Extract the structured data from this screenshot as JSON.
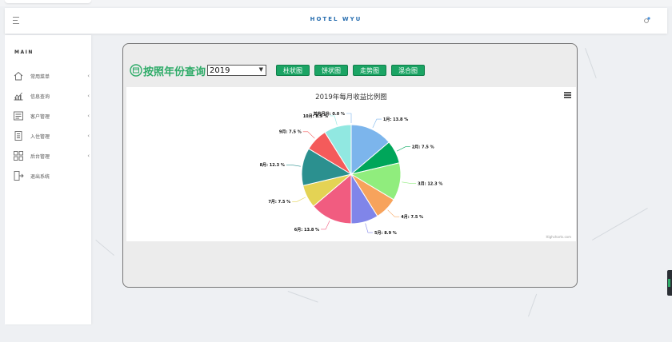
{
  "header": {
    "brand": "HOTEL WYU"
  },
  "sidebar": {
    "section_label": "MAIN",
    "items": [
      {
        "label": "常用菜单",
        "icon": "home-icon",
        "has_children": true
      },
      {
        "label": "信息查询",
        "icon": "chart-icon",
        "has_children": true
      },
      {
        "label": "客户管理",
        "icon": "customer-icon",
        "has_children": true
      },
      {
        "label": "入住管理",
        "icon": "checkin-icon",
        "has_children": true
      },
      {
        "label": "后台管理",
        "icon": "grid-icon",
        "has_children": true
      },
      {
        "label": "退出系统",
        "icon": "logout-icon",
        "has_children": false
      }
    ],
    "chevron": "‹"
  },
  "toolbar": {
    "title": "按照年份查询",
    "year_value": "2019",
    "buttons": [
      "柱状图",
      "饼状图",
      "走势图",
      "混合图"
    ]
  },
  "chart_data": {
    "type": "pie",
    "title": "2019年每月收益比例图",
    "credit": "Highcharts.com",
    "slices": [
      {
        "label": "1月: 13.8 %",
        "value": 13.8,
        "color": "#7cb5ec"
      },
      {
        "label": "2月: 7.5 %",
        "value": 7.5,
        "color": "#00a65a"
      },
      {
        "label": "3月: 12.3 %",
        "value": 12.3,
        "color": "#90ed7d"
      },
      {
        "label": "4月: 7.5 %",
        "value": 7.5,
        "color": "#f7a35c"
      },
      {
        "label": "5月: 8.9 %",
        "value": 8.9,
        "color": "#8085e9"
      },
      {
        "label": "6月: 13.8 %",
        "value": 13.8,
        "color": "#f15c80"
      },
      {
        "label": "7月: 7.5 %",
        "value": 7.5,
        "color": "#e4d354"
      },
      {
        "label": "8月: 12.3 %",
        "value": 12.3,
        "color": "#2b908f"
      },
      {
        "label": "9月: 7.5 %",
        "value": 7.5,
        "color": "#f45b5b"
      },
      {
        "label": "10月: 8.9 %",
        "value": 8.9,
        "color": "#91e8e1"
      },
      {
        "label": "其他月份: 0.0 %",
        "value": 0.0,
        "color": "#7cb5ec"
      }
    ]
  }
}
